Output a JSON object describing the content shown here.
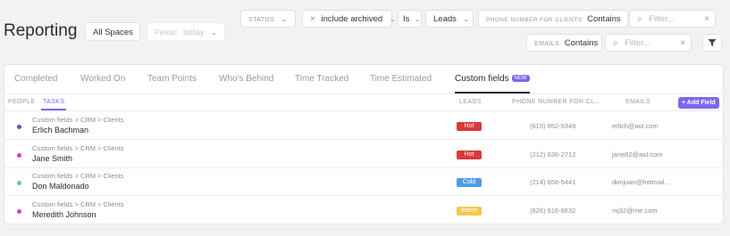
{
  "header": {
    "title": "Reporting",
    "space_button": "All Spaces",
    "period_label": "Period:",
    "period_value": "today"
  },
  "filters": {
    "status": {
      "label": "STATUS"
    },
    "archived": {
      "value": "include archived"
    },
    "operator": {
      "value": "Is"
    },
    "leads": {
      "value": "Leads"
    },
    "phone": {
      "label": "PHONE NUMBER FOR CLIENTS",
      "op": "Contains",
      "placeholder": "Filter..."
    },
    "emails": {
      "label": "EMAILS",
      "op": "Contains",
      "placeholder": "Filter..."
    }
  },
  "tabs": [
    {
      "label": "Completed"
    },
    {
      "label": "Worked On"
    },
    {
      "label": "Team Points"
    },
    {
      "label": "Who's Behind"
    },
    {
      "label": "Time Tracked"
    },
    {
      "label": "Time Estimated"
    },
    {
      "label": "Custom fields",
      "badge": "NEW",
      "active": true
    }
  ],
  "subtabs": [
    {
      "label": "PEOPLE"
    },
    {
      "label": "TASKS",
      "active": true
    }
  ],
  "columns": {
    "leads": "LEADS",
    "phone": "PHONE NUMBER FOR CL...",
    "emails": "EMAILS",
    "add": "+ Add Field"
  },
  "rows": [
    {
      "path": "Custom fields > CRM > Clients",
      "name": "Erlich Bachman",
      "lead": "Hot",
      "lead_color": "#d93a3a",
      "phone": "(615) 852-5349",
      "email": "erlich@aol.com",
      "dot": "#7b3fd6"
    },
    {
      "path": "Custom fields > CRM > Clients",
      "name": "Jane Smith",
      "lead": "Hot",
      "lead_color": "#d93a3a",
      "phone": "(212) 636-2712",
      "email": "jane82@aol.com",
      "dot": "#d63fc2"
    },
    {
      "path": "Custom fields > CRM > Clients",
      "name": "Don Maldonado",
      "lead": "Cold",
      "lead_color": "#4f9ee8",
      "phone": "(214) 656-5441",
      "email": "donjuan@hotmail...",
      "dot": "#64c8b0"
    },
    {
      "path": "Custom fields > CRM > Clients",
      "name": "Meredith Johnson",
      "lead": "Warm",
      "lead_color": "#f2c84b",
      "phone": "(626) 616-6632",
      "email": "mj32@me.com",
      "dot": "#d63fc2"
    }
  ]
}
